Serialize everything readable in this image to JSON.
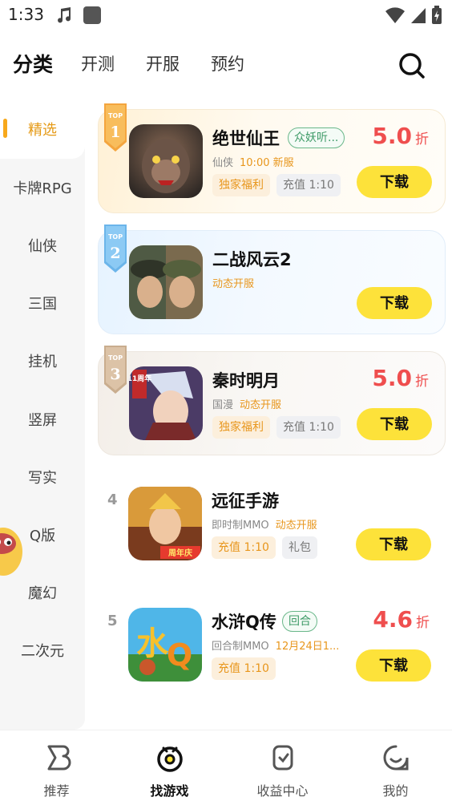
{
  "status_bar": {
    "time": "1:33"
  },
  "top_nav": {
    "tabs": [
      "分类",
      "开测",
      "开服",
      "预约"
    ],
    "active_index": 0
  },
  "sidebar": {
    "items": [
      "精选",
      "卡牌RPG",
      "仙侠",
      "三国",
      "挂机",
      "竖屏",
      "写实",
      "Q版",
      "魔幻",
      "二次元"
    ],
    "active_index": 0
  },
  "games": [
    {
      "rank": "TOP 1",
      "name": "绝世仙王",
      "tag": "众妖听...",
      "genre": "仙侠",
      "info": "10:00 新服",
      "chips": [
        "独家福利",
        "充值 1:10"
      ],
      "discount": "5.0",
      "discount_unit": "折",
      "download": "下载"
    },
    {
      "rank": "TOP 2",
      "name": "二战风云2",
      "tag": "",
      "genre": "",
      "info": "动态开服",
      "chips": [],
      "discount": "",
      "discount_unit": "",
      "download": "下载"
    },
    {
      "rank": "TOP 3",
      "name": "秦时明月",
      "tag": "",
      "genre": "国漫",
      "info": "动态开服",
      "chips": [
        "独家福利",
        "充值 1:10"
      ],
      "discount": "5.0",
      "discount_unit": "折",
      "download": "下载",
      "icon_badge": "11周年"
    },
    {
      "rank": "4",
      "name": "远征手游",
      "tag": "",
      "genre": "即时制MMO",
      "info": "动态开服",
      "chips": [
        "充值 1:10",
        "礼包"
      ],
      "discount": "",
      "discount_unit": "",
      "download": "下载",
      "icon_badge": "周年庆"
    },
    {
      "rank": "5",
      "name": "水浒Q传",
      "tag": "回合",
      "genre": "回合制MMO",
      "info": "12月24日1...",
      "chips": [
        "充值 1:10"
      ],
      "discount": "4.6",
      "discount_unit": "折",
      "download": "下载"
    }
  ],
  "bottom_nav": {
    "items": [
      "推荐",
      "找游戏",
      "收益中心",
      "我的"
    ],
    "active_index": 1
  },
  "colors": {
    "accent_yellow": "#fde23a",
    "accent_orange": "#e8961c",
    "discount_red": "#ef4e4e",
    "tag_green": "#3f9b68"
  }
}
